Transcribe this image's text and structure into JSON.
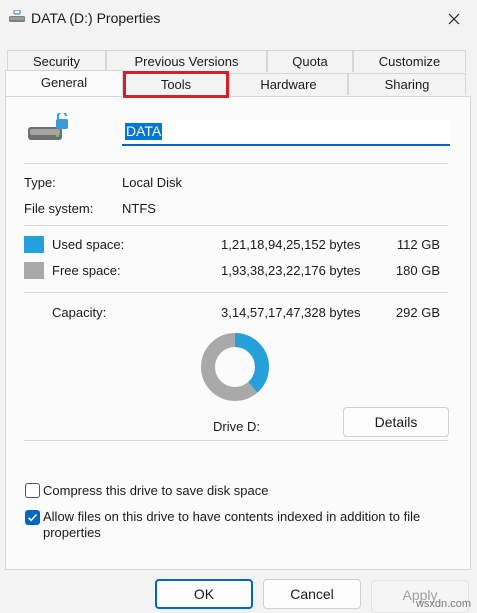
{
  "window": {
    "title": "DATA (D:) Properties"
  },
  "tabs_row1": [
    {
      "label": "Security"
    },
    {
      "label": "Previous Versions"
    },
    {
      "label": "Quota"
    },
    {
      "label": "Customize"
    }
  ],
  "tabs_row2": [
    {
      "label": "General",
      "active": true
    },
    {
      "label": "Tools",
      "highlighted": true
    },
    {
      "label": "Hardware"
    },
    {
      "label": "Sharing"
    }
  ],
  "drive": {
    "name_value": "DATA",
    "type_label": "Type:",
    "type_value": "Local Disk",
    "fs_label": "File system:",
    "fs_value": "NTFS"
  },
  "space": {
    "used_label": "Used space:",
    "used_bytes": "1,21,18,94,25,152 bytes",
    "used_size": "112 GB",
    "used_color": "#26a0da",
    "free_label": "Free space:",
    "free_bytes": "1,93,38,23,22,176 bytes",
    "free_size": "180 GB",
    "free_color": "#a9a9a9",
    "capacity_label": "Capacity:",
    "capacity_bytes": "3,14,57,17,47,328 bytes",
    "capacity_size": "292 GB",
    "used_fraction": 0.384
  },
  "drive_label": "Drive D:",
  "details_button": "Details",
  "options": {
    "compress_label": "Compress this drive to save disk space",
    "compress_checked": false,
    "index_label_line1": "Allow files on this drive to have contents indexed in addition to file",
    "index_label_line2": "properties",
    "index_checked": true
  },
  "buttons": {
    "ok": "OK",
    "cancel": "Cancel",
    "apply": "Apply"
  },
  "watermark": "wsxdn.com"
}
